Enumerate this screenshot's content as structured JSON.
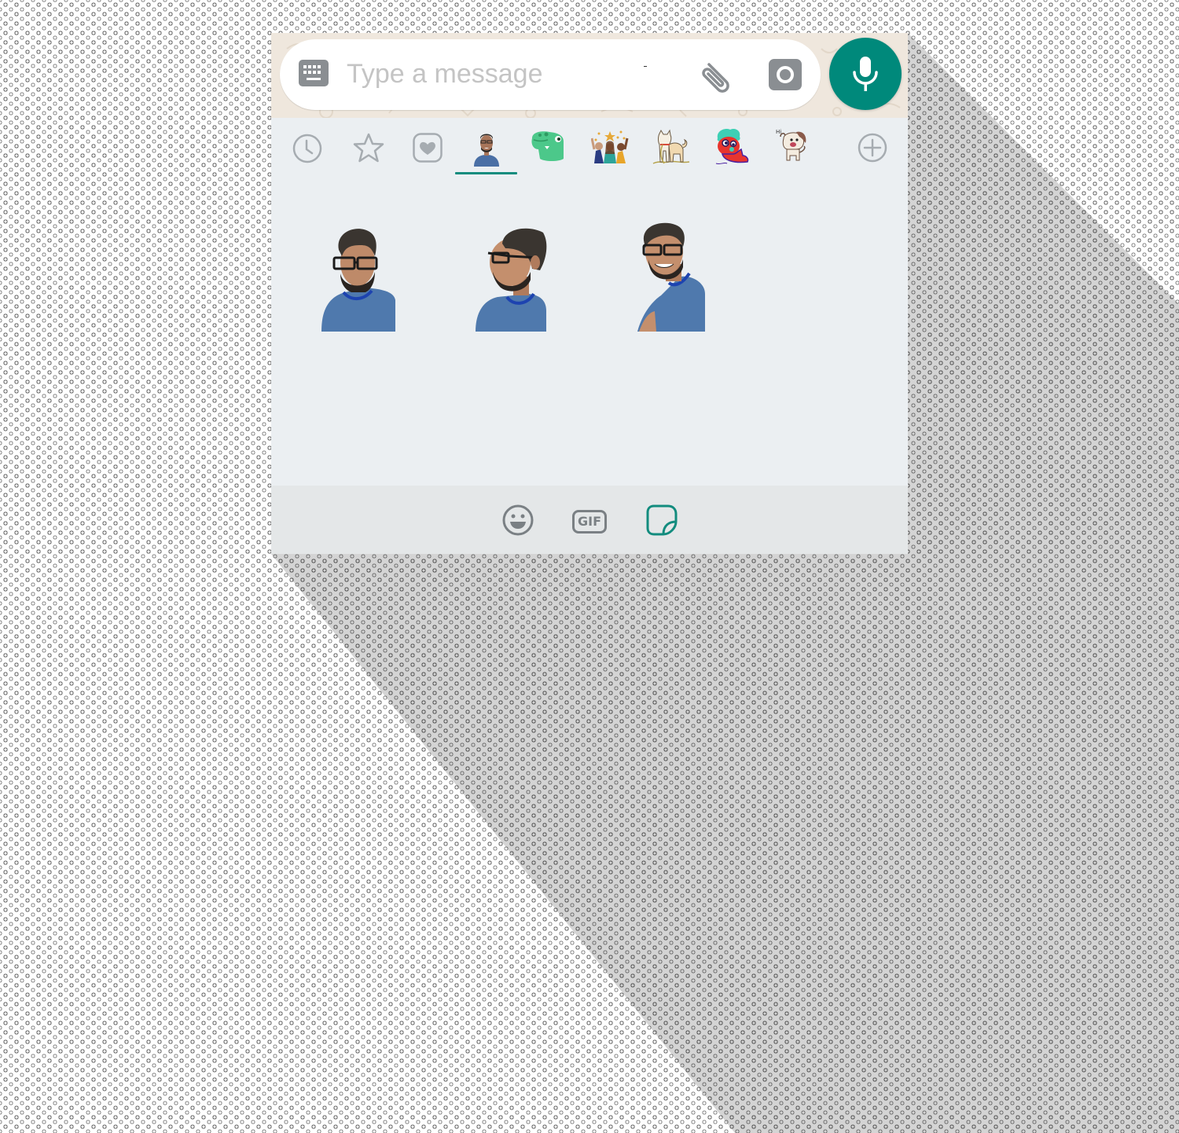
{
  "input_bar": {
    "placeholder": "Type a message",
    "icons": {
      "keyboard": "keyboard-icon",
      "attach": "paperclip-icon",
      "camera": "camera-icon",
      "voice": "microphone-icon"
    }
  },
  "sticker_tabs": [
    {
      "name": "recent",
      "icon": "clock-icon",
      "active": false
    },
    {
      "name": "starred",
      "icon": "star-icon",
      "active": false
    },
    {
      "name": "favorites",
      "icon": "heart-icon",
      "active": false
    },
    {
      "name": "personal-pack",
      "icon": "person-sticker-thumbnail",
      "active": true
    },
    {
      "name": "dino-pack",
      "icon": "green-dinosaur-sticker-thumbnail",
      "active": false
    },
    {
      "name": "friends-pack",
      "icon": "celebrating-friends-sticker-thumbnail",
      "active": false
    },
    {
      "name": "dog-pack",
      "icon": "shiba-dog-sticker-thumbnail",
      "active": false
    },
    {
      "name": "red-character-pack",
      "icon": "red-character-sticker-thumbnail",
      "active": false
    },
    {
      "name": "puppy-pack",
      "icon": "puppy-hi-sticker-thumbnail",
      "active": false
    },
    {
      "name": "add",
      "icon": "plus-circle-icon",
      "active": false
    }
  ],
  "stickers": [
    {
      "name": "man-frowning-sticker"
    },
    {
      "name": "man-looking-side-sticker"
    },
    {
      "name": "man-smiling-sticker"
    }
  ],
  "bottom_bar": {
    "items": [
      {
        "name": "emoji",
        "icon": "smiley-icon",
        "active": false
      },
      {
        "name": "gif",
        "icon": "gif-icon",
        "label": "GIF",
        "active": false
      },
      {
        "name": "stickers",
        "icon": "sticker-icon",
        "active": true
      }
    ]
  },
  "colors": {
    "accent": "#00897b",
    "tab_indicator": "#128c7e",
    "icon_gray": "#8a8e92",
    "panel_bg": "#ebeff2",
    "bottom_bar_bg": "#e4e7e8",
    "input_bar_bg": "#efe7dd"
  }
}
